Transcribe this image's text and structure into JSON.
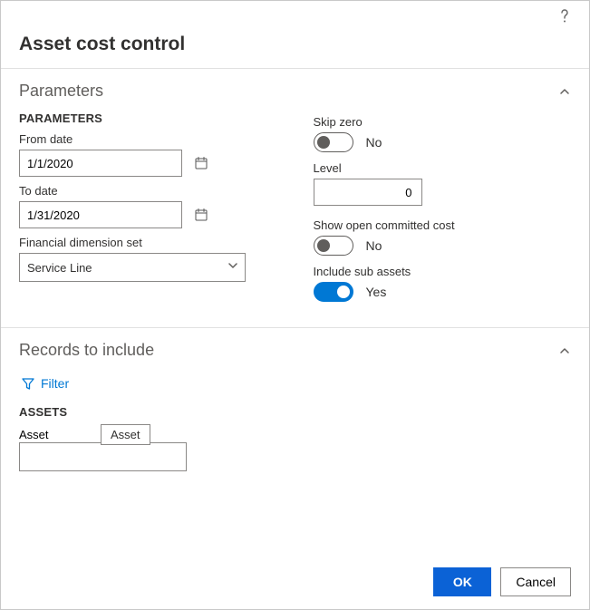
{
  "title": "Asset cost control",
  "sections": {
    "parameters": {
      "heading": "Parameters"
    },
    "records": {
      "heading": "Records to include"
    }
  },
  "parameters": {
    "caps_heading": "PARAMETERS",
    "from_date": {
      "label": "From date",
      "value": "1/1/2020"
    },
    "to_date": {
      "label": "To date",
      "value": "1/31/2020"
    },
    "fin_dim": {
      "label": "Financial dimension set",
      "value": "Service Line"
    },
    "skip_zero": {
      "label": "Skip zero",
      "value": false,
      "text": "No"
    },
    "level": {
      "label": "Level",
      "value": "0"
    },
    "show_open": {
      "label": "Show open committed cost",
      "value": false,
      "text": "No"
    },
    "include_sub": {
      "label": "Include sub assets",
      "value": true,
      "text": "Yes"
    }
  },
  "records": {
    "filter_label": "Filter",
    "assets_heading": "ASSETS",
    "asset_label": "Asset",
    "asset_tab": "Asset",
    "asset_value": ""
  },
  "footer": {
    "ok": "OK",
    "cancel": "Cancel"
  }
}
